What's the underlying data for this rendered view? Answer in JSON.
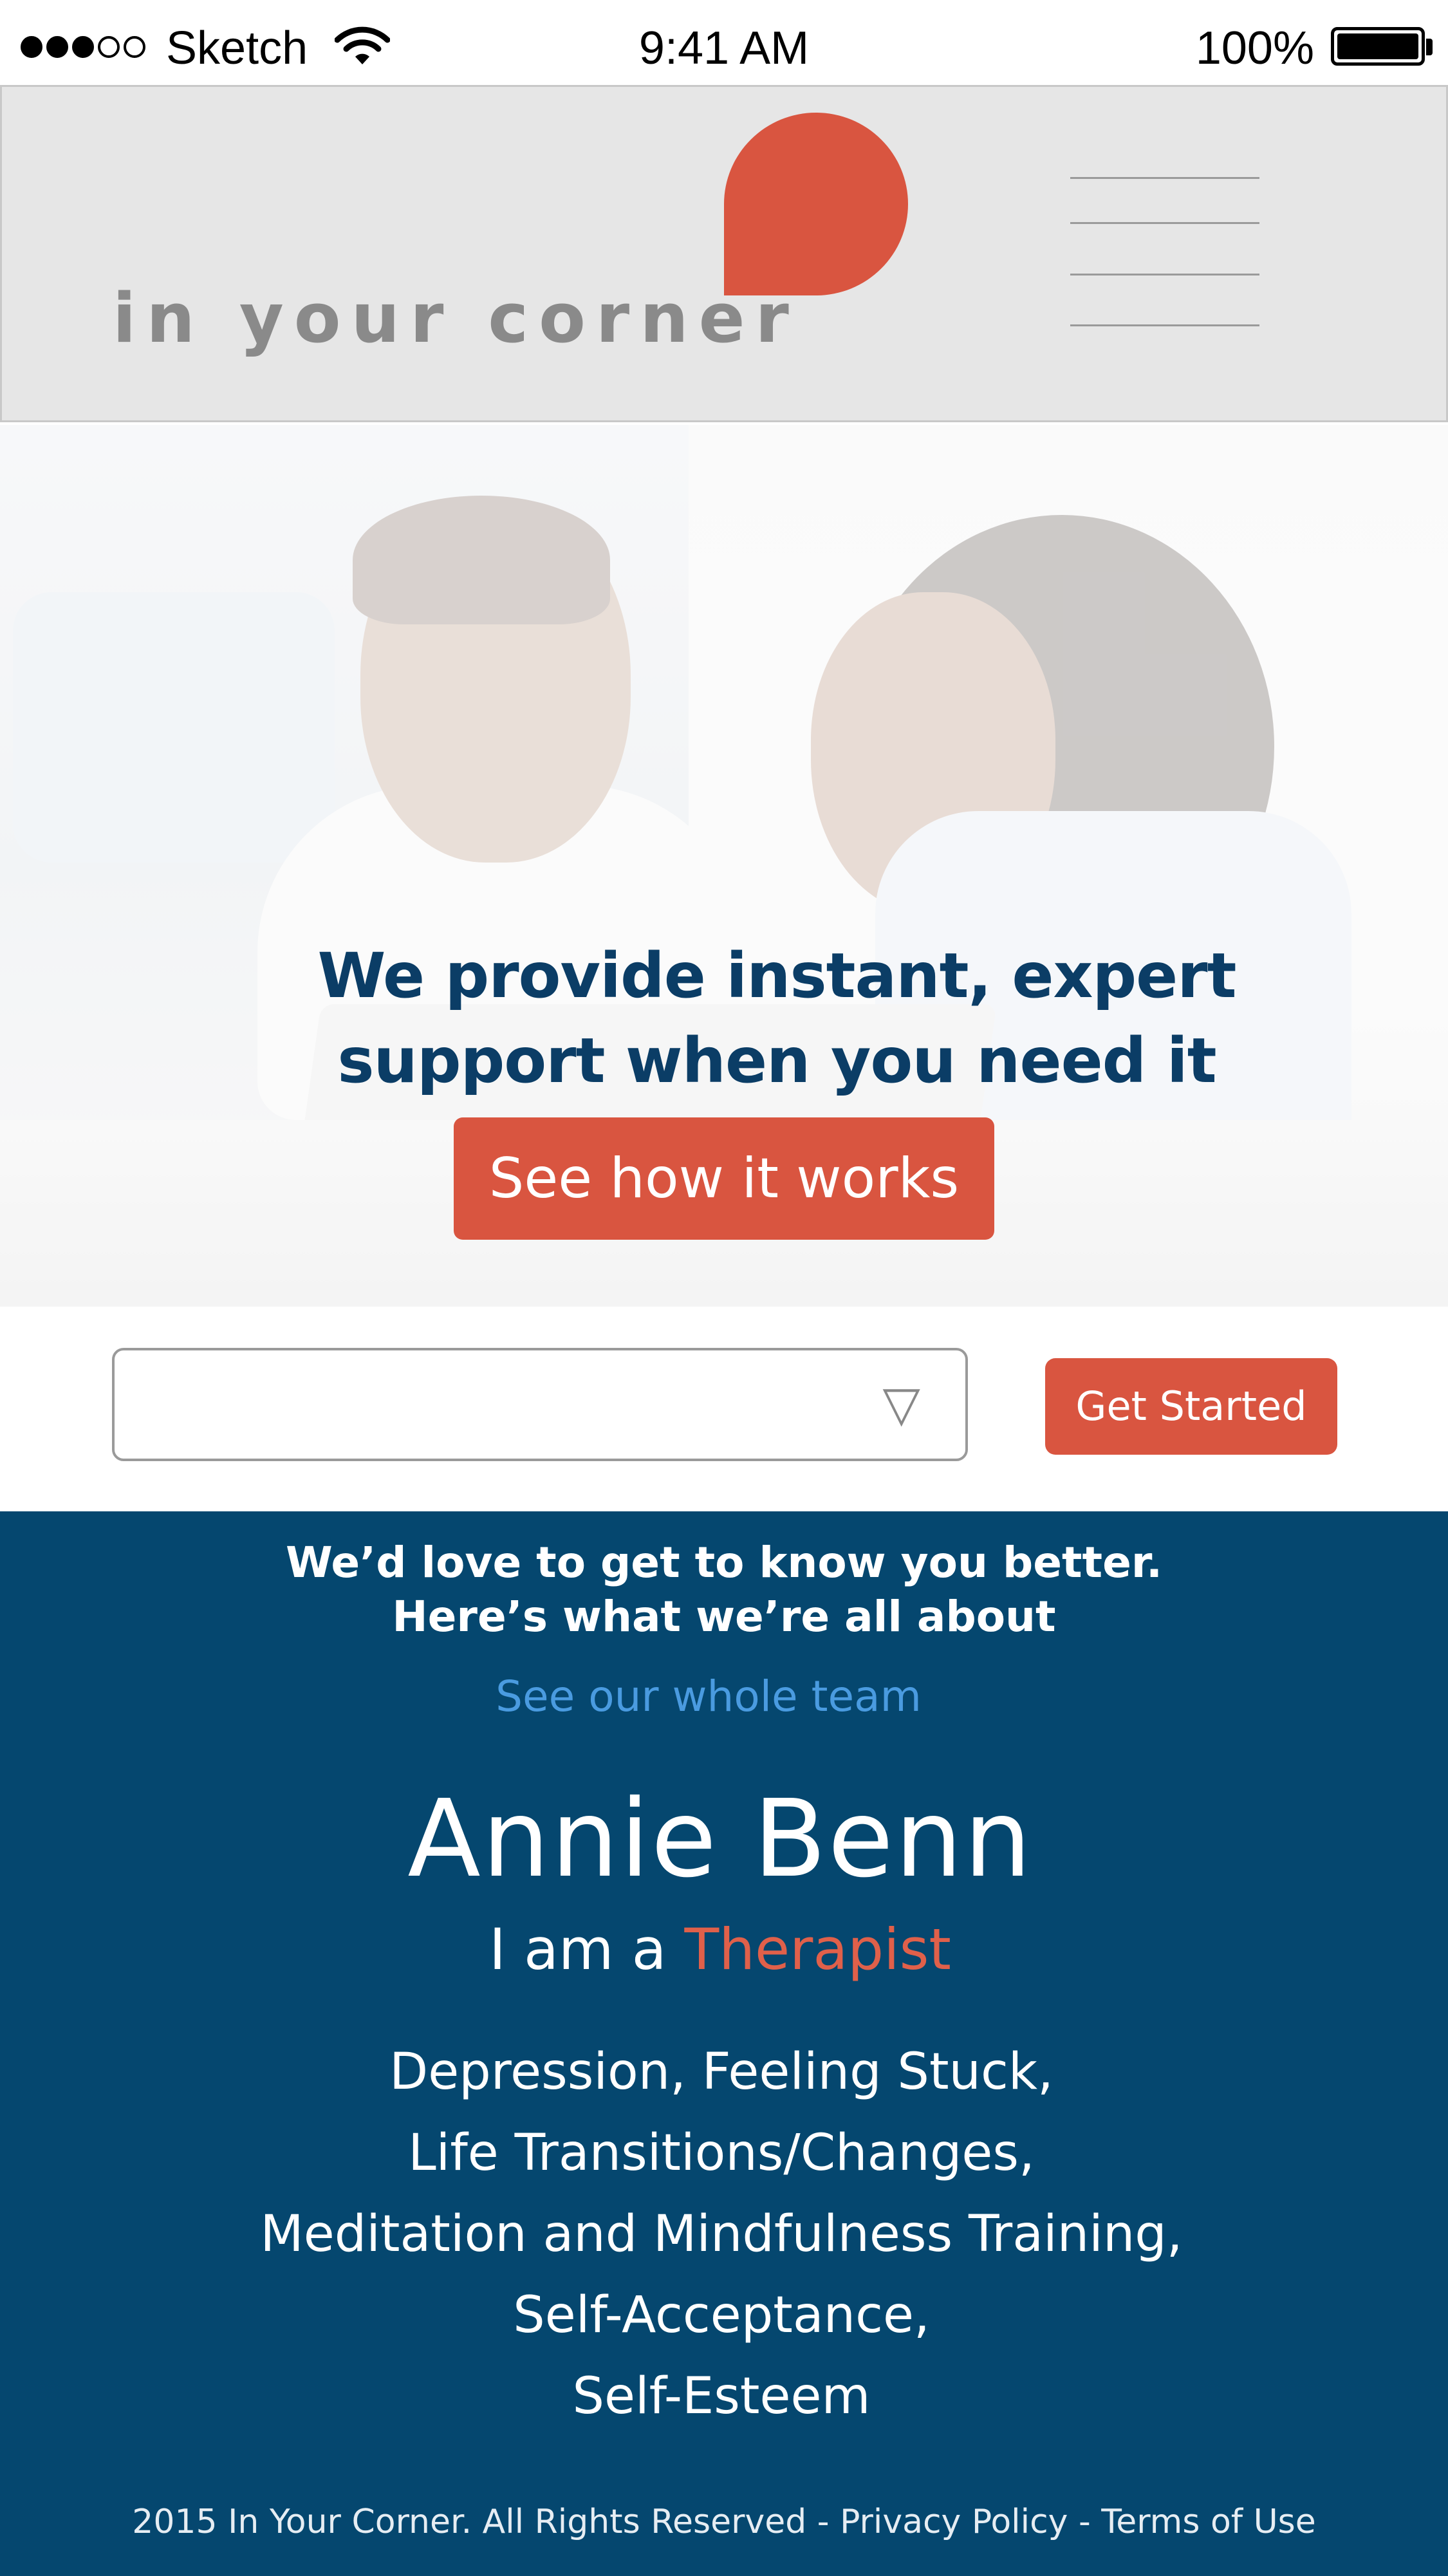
{
  "status_bar": {
    "carrier": "Sketch",
    "time": "9:41 AM",
    "battery": "100%",
    "signal_bars_filled": 3,
    "signal_bars_total": 5
  },
  "brand": {
    "logo_text": "in your corner",
    "accent_color": "#d95540",
    "primary_color": "#05476f",
    "headline_color": "#0b3d66",
    "link_color": "#4a9be0"
  },
  "hero": {
    "headline_line1": "We provide instant, expert",
    "headline_line2": "support when you need it",
    "cta_label": "See how it works"
  },
  "selector": {
    "value": "",
    "arrow_icon": "triangle-down-icon",
    "start_label": "Get Started"
  },
  "about": {
    "intro_line1": "We’d love to get to know you better.",
    "intro_line2": "Here’s what we’re all about",
    "team_link": "See our whole team",
    "name": "Annie Benn",
    "role_prefix": "I am a ",
    "role": "Therapist",
    "specialties": [
      "Depression, Feeling Stuck,",
      "Life Transitions/Changes,",
      "Meditation and Mindfulness Training,",
      "Self-Acceptance,",
      "Self-Esteem"
    ]
  },
  "footer": {
    "copyright": "2015 In Your Corner. All Rights Reserved",
    "separator": " - ",
    "privacy": "Privacy Policy",
    "terms": "Terms of Use"
  }
}
